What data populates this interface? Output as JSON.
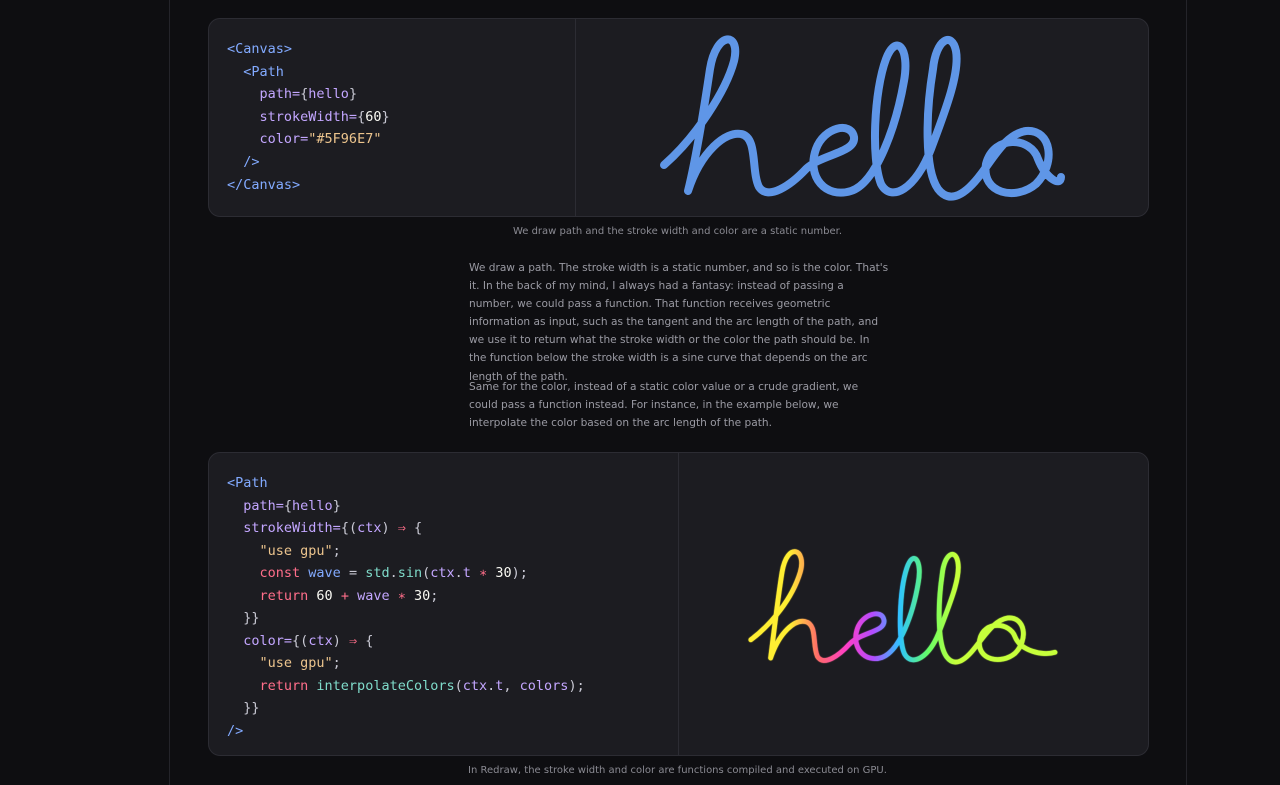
{
  "card1": {
    "code": [
      {
        "indent": 0,
        "tokens": [
          {
            "t": "<Canvas>",
            "c": "tag"
          }
        ]
      },
      {
        "indent": 1,
        "tokens": [
          {
            "t": "<Path",
            "c": "tag"
          }
        ]
      },
      {
        "indent": 2,
        "tokens": [
          {
            "t": "path=",
            "c": "attr"
          },
          {
            "t": "{",
            "c": "pun"
          },
          {
            "t": "hello",
            "c": "attr"
          },
          {
            "t": "}",
            "c": "pun"
          }
        ]
      },
      {
        "indent": 2,
        "tokens": [
          {
            "t": "strokeWidth=",
            "c": "attr"
          },
          {
            "t": "{",
            "c": "pun"
          },
          {
            "t": "60",
            "c": "num"
          },
          {
            "t": "}",
            "c": "pun"
          }
        ]
      },
      {
        "indent": 2,
        "tokens": [
          {
            "t": "color=",
            "c": "attr"
          },
          {
            "t": "\"#5F96E7\"",
            "c": "str"
          }
        ]
      },
      {
        "indent": 1,
        "tokens": [
          {
            "t": "/>",
            "c": "tag"
          }
        ]
      },
      {
        "indent": 0,
        "tokens": [
          {
            "t": "</Canvas>",
            "c": "tag"
          }
        ]
      }
    ],
    "preview_color": "#5F96E7"
  },
  "caption1": "We draw path and the stroke width and color are a static number.",
  "paragraphs": [
    "We draw a path. The stroke width is a static number, and so is the color. That's it. In the back of my mind, I always had a fantasy: instead of passing a number, we could pass a function. That function receives geometric information as input, such as the tangent and the arc length of the path, and we use it to return what the stroke width or the color the path should be. In the function below the stroke width is a sine curve that depends on the arc length of the path.",
    "Same for the color, instead of a static color value or a crude gradient, we could pass a function instead. For instance, in the example below, we interpolate the color based on the arc length of the path."
  ],
  "card2": {
    "code": [
      {
        "indent": 0,
        "tokens": [
          {
            "t": "<Path",
            "c": "tag"
          }
        ]
      },
      {
        "indent": 1,
        "tokens": [
          {
            "t": "path=",
            "c": "attr"
          },
          {
            "t": "{",
            "c": "pun"
          },
          {
            "t": "hello",
            "c": "attr"
          },
          {
            "t": "}",
            "c": "pun"
          }
        ]
      },
      {
        "indent": 1,
        "tokens": [
          {
            "t": "strokeWidth=",
            "c": "attr"
          },
          {
            "t": "{(",
            "c": "pun"
          },
          {
            "t": "ctx",
            "c": "attr"
          },
          {
            "t": ") ",
            "c": "pun"
          },
          {
            "t": "⇒",
            "c": "kw"
          },
          {
            "t": " {",
            "c": "pun"
          }
        ]
      },
      {
        "indent": 2,
        "tokens": [
          {
            "t": "\"use gpu\"",
            "c": "str"
          },
          {
            "t": ";",
            "c": "pun"
          }
        ]
      },
      {
        "indent": 2,
        "tokens": [
          {
            "t": "const ",
            "c": "kw"
          },
          {
            "t": "wave",
            "c": "tag"
          },
          {
            "t": " = ",
            "c": "pun"
          },
          {
            "t": "std",
            "c": "fn"
          },
          {
            "t": ".",
            "c": "pun"
          },
          {
            "t": "sin",
            "c": "fn"
          },
          {
            "t": "(",
            "c": "pun"
          },
          {
            "t": "ctx",
            "c": "attr"
          },
          {
            "t": ".",
            "c": "pun"
          },
          {
            "t": "t",
            "c": "attr"
          },
          {
            "t": " ∗ ",
            "c": "kw"
          },
          {
            "t": "30",
            "c": "num"
          },
          {
            "t": ");",
            "c": "pun"
          }
        ]
      },
      {
        "indent": 2,
        "tokens": [
          {
            "t": "return ",
            "c": "kw"
          },
          {
            "t": "60",
            "c": "num"
          },
          {
            "t": " + ",
            "c": "kw"
          },
          {
            "t": "wave",
            "c": "attr"
          },
          {
            "t": " ∗ ",
            "c": "kw"
          },
          {
            "t": "30",
            "c": "num"
          },
          {
            "t": ";",
            "c": "pun"
          }
        ]
      },
      {
        "indent": 1,
        "tokens": [
          {
            "t": "}}",
            "c": "pun"
          }
        ]
      },
      {
        "indent": 1,
        "tokens": [
          {
            "t": "color=",
            "c": "attr"
          },
          {
            "t": "{(",
            "c": "pun"
          },
          {
            "t": "ctx",
            "c": "attr"
          },
          {
            "t": ") ",
            "c": "pun"
          },
          {
            "t": "⇒",
            "c": "kw"
          },
          {
            "t": " {",
            "c": "pun"
          }
        ]
      },
      {
        "indent": 2,
        "tokens": [
          {
            "t": "\"use gpu\"",
            "c": "str"
          },
          {
            "t": ";",
            "c": "pun"
          }
        ]
      },
      {
        "indent": 2,
        "tokens": [
          {
            "t": "return ",
            "c": "kw"
          },
          {
            "t": "interpolateColors",
            "c": "fn"
          },
          {
            "t": "(",
            "c": "pun"
          },
          {
            "t": "ctx",
            "c": "attr"
          },
          {
            "t": ".",
            "c": "pun"
          },
          {
            "t": "t",
            "c": "attr"
          },
          {
            "t": ", ",
            "c": "pun"
          },
          {
            "t": "colors",
            "c": "attr"
          },
          {
            "t": ");",
            "c": "pun"
          }
        ]
      },
      {
        "indent": 1,
        "tokens": [
          {
            "t": "}}",
            "c": "pun"
          }
        ]
      },
      {
        "indent": 0,
        "tokens": [
          {
            "t": "/>",
            "c": "tag"
          }
        ]
      }
    ],
    "gradient_colors": [
      "#ffee33",
      "#ff6a6a",
      "#ff3ec8",
      "#b24dff",
      "#2ec4ff",
      "#66ff66",
      "#c6ff3a"
    ]
  },
  "caption2": "In Redraw, the stroke width and color are functions compiled and executed on GPU."
}
